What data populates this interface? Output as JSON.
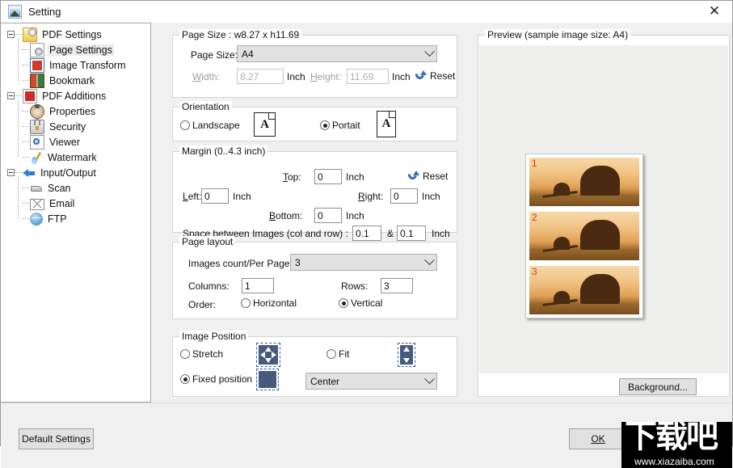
{
  "window": {
    "title": "Setting",
    "icon": "image-app-icon",
    "close_label": "✕"
  },
  "tree": {
    "nodes": [
      {
        "label": "PDF Settings",
        "level": 0,
        "icon": "pdf-settings-icon",
        "expander": true,
        "selected": false
      },
      {
        "label": "Page Settings",
        "level": 1,
        "icon": "page-settings-icon",
        "expander": false,
        "selected": true
      },
      {
        "label": "Image Transform",
        "level": 1,
        "icon": "image-transform-icon",
        "expander": false,
        "selected": false
      },
      {
        "label": "Bookmark",
        "level": 1,
        "icon": "bookmark-icon",
        "expander": false,
        "selected": false
      },
      {
        "label": "PDF Additions",
        "level": 0,
        "icon": "pdf-additions-icon",
        "expander": true,
        "selected": false
      },
      {
        "label": "Properties",
        "level": 1,
        "icon": "properties-icon",
        "expander": false,
        "selected": false
      },
      {
        "label": "Security",
        "level": 1,
        "icon": "security-icon",
        "expander": false,
        "selected": false
      },
      {
        "label": "Viewer",
        "level": 1,
        "icon": "viewer-icon",
        "expander": false,
        "selected": false
      },
      {
        "label": "Watermark",
        "level": 1,
        "icon": "watermark-icon",
        "expander": false,
        "selected": false
      },
      {
        "label": "Input/Output",
        "level": 0,
        "icon": "input-output-icon",
        "expander": true,
        "selected": false
      },
      {
        "label": "Scan",
        "level": 1,
        "icon": "scan-icon",
        "expander": false,
        "selected": false
      },
      {
        "label": "Email",
        "level": 1,
        "icon": "email-icon",
        "expander": false,
        "selected": false
      },
      {
        "label": "FTP",
        "level": 1,
        "icon": "ftp-icon",
        "expander": false,
        "selected": false
      }
    ]
  },
  "page_size": {
    "legend": "Page Size : w8.27 x h11.69",
    "size_label": "Page Size:",
    "size_value": "A4",
    "size_options": [
      "A4"
    ],
    "width_label": "Width:",
    "width_value": "8.27",
    "width_unit": "Inch",
    "height_label": "Height:",
    "height_value": "11.69",
    "height_unit": "Inch",
    "reset_label": "Reset"
  },
  "orientation": {
    "legend": "Orientation",
    "landscape_label": "Landscape",
    "landscape_selected": false,
    "landscape_glyph": "A",
    "portrait_label": "Portait",
    "portrait_selected": true,
    "portrait_glyph": "A"
  },
  "margin": {
    "legend": "Margin (0..4.3 inch)",
    "top_label": "Top:",
    "top_value": "0",
    "top_unit": "Inch",
    "left_label": "Left:",
    "left_value": "0",
    "left_unit": "Inch",
    "right_label": "Right:",
    "right_value": "0",
    "right_unit": "Inch",
    "bottom_label": "Bottom:",
    "bottom_value": "0",
    "bottom_unit": "Inch",
    "reset_label": "Reset",
    "space_label": "Space between Images (col and row) :",
    "space_col_value": "0.1",
    "space_amp": "&",
    "space_row_value": "0.1",
    "space_unit": "Inch"
  },
  "page_layout": {
    "legend": "Page layout",
    "count_label": "Images count/Per Page",
    "count_value": "3",
    "count_options": [
      "3"
    ],
    "columns_label": "Columns:",
    "columns_value": "1",
    "rows_label": "Rows:",
    "rows_value": "3",
    "order_label": "Order:",
    "horizontal_label": "Horizontal",
    "horizontal_selected": false,
    "vertical_label": "Vertical",
    "vertical_selected": true
  },
  "image_position": {
    "legend": "Image Position",
    "stretch_label": "Stretch",
    "stretch_selected": false,
    "fit_label": "Fit",
    "fit_selected": false,
    "fixed_label": "Fixed position",
    "fixed_selected": true,
    "align_value": "Center",
    "align_options": [
      "Center"
    ],
    "stretch_icon": "four-way-arrows-icon",
    "fit_icon": "vertical-arrows-icon",
    "fixed_icon": "solid-square-icon"
  },
  "preview": {
    "legend": "Preview (sample image size: A4)",
    "background_button": "Background...",
    "thumbs": [
      {
        "num": "1"
      },
      {
        "num": "2"
      },
      {
        "num": "3"
      }
    ]
  },
  "footer": {
    "default_settings": "Default Settings",
    "ok": "OK"
  },
  "watermark": {
    "cn_text": "下载吧",
    "url": "www.xiazaiba.com"
  }
}
